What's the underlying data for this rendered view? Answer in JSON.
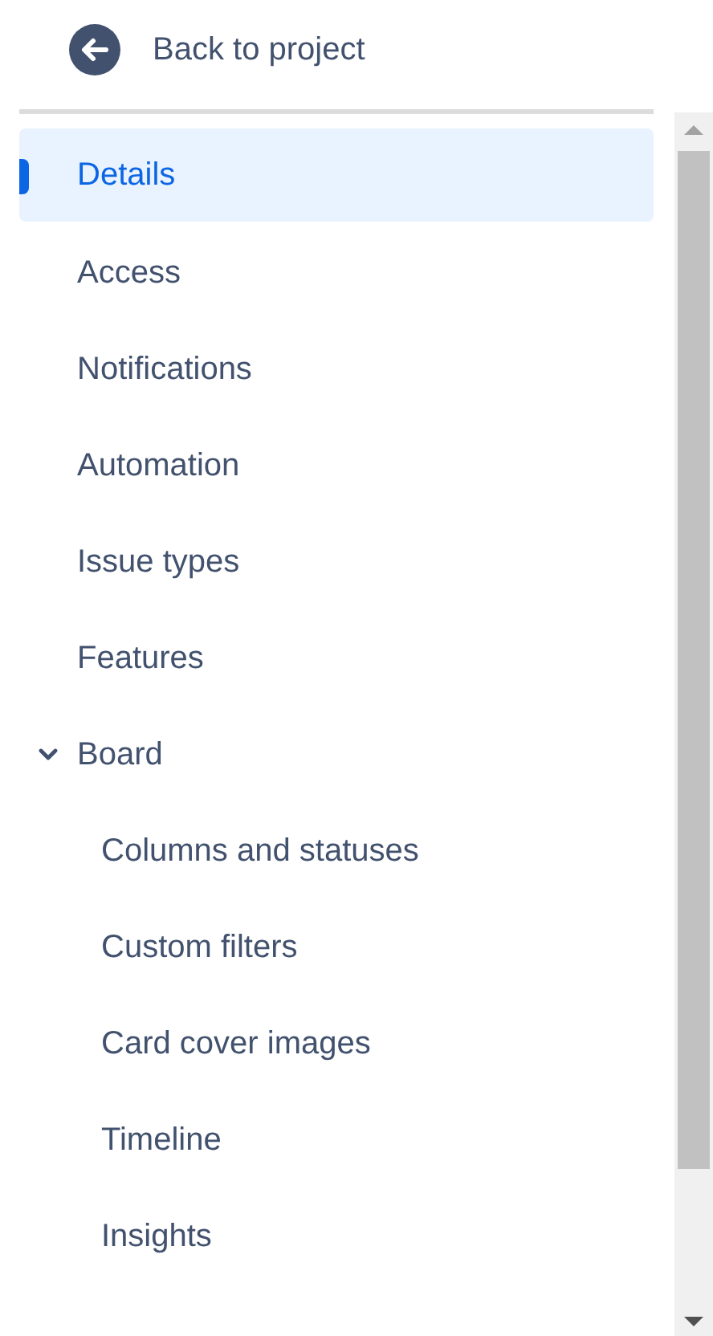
{
  "back_link": {
    "label": "Back to project"
  },
  "sidebar": {
    "items": [
      {
        "label": "Details",
        "selected": true
      },
      {
        "label": "Access",
        "selected": false
      },
      {
        "label": "Notifications",
        "selected": false
      },
      {
        "label": "Automation",
        "selected": false
      },
      {
        "label": "Issue types",
        "selected": false
      },
      {
        "label": "Features",
        "selected": false
      },
      {
        "label": "Board",
        "selected": false,
        "expanded": true,
        "children": [
          {
            "label": "Columns and statuses",
            "selected": false
          },
          {
            "label": "Custom filters",
            "selected": false
          },
          {
            "label": "Card cover images",
            "selected": false
          },
          {
            "label": "Timeline",
            "selected": false
          },
          {
            "label": "Insights",
            "selected": false
          }
        ]
      }
    ]
  }
}
